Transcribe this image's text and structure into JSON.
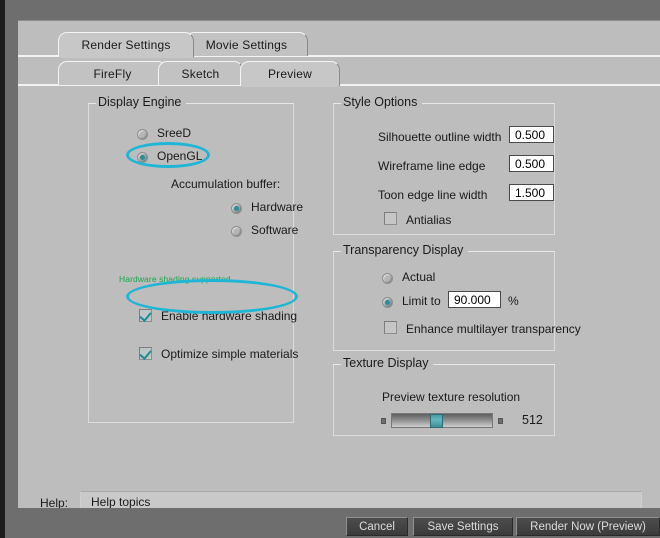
{
  "window": {
    "title_tabs_row1": [
      {
        "label": "Render Settings",
        "selected": true
      },
      {
        "label": "Movie Settings",
        "selected": false
      }
    ],
    "title_tabs_row2": [
      {
        "label": "FireFly",
        "selected": false
      },
      {
        "label": "Sketch",
        "selected": false
      },
      {
        "label": "Preview",
        "selected": true
      }
    ]
  },
  "display_engine": {
    "legend": "Display Engine",
    "options": [
      {
        "label": "SreeD",
        "selected": false
      },
      {
        "label": "OpenGL",
        "selected": true
      }
    ],
    "accumulation_label": "Accumulation buffer:",
    "accumulation_options": [
      {
        "label": "Hardware",
        "selected": true
      },
      {
        "label": "Software",
        "selected": false
      }
    ],
    "hardware_note": "Hardware shading supported",
    "hardware_note_color": "#18a64c",
    "checkboxes": [
      {
        "label": "Enable hardware shading",
        "checked": true
      },
      {
        "label": "Optimize simple materials",
        "checked": true
      }
    ]
  },
  "style_options": {
    "legend": "Style Options",
    "rows": [
      {
        "label": "Silhouette outline width",
        "value": "0.500"
      },
      {
        "label": "Wireframe line edge",
        "value": "0.500"
      },
      {
        "label": "Toon edge line width",
        "value": "1.500"
      }
    ],
    "antialias": {
      "label": "Antialias",
      "checked": false
    }
  },
  "transparency_display": {
    "legend": "Transparency Display",
    "actual": {
      "label": "Actual",
      "selected": false
    },
    "limit": {
      "label": "Limit to",
      "selected": true,
      "value": "90.000",
      "unit": "%"
    },
    "enhance": {
      "label": "Enhance multilayer transparency",
      "checked": false
    }
  },
  "texture_display": {
    "legend": "Texture Display",
    "slider_label": "Preview texture resolution",
    "value": "512",
    "thumb_percent": 38
  },
  "help": {
    "label": "Help:",
    "text": "Help topics"
  },
  "footer": {
    "cancel": "Cancel",
    "save": "Save Settings",
    "render": "Render Now (Preview)"
  },
  "highlight_color": "#1fb6d6"
}
